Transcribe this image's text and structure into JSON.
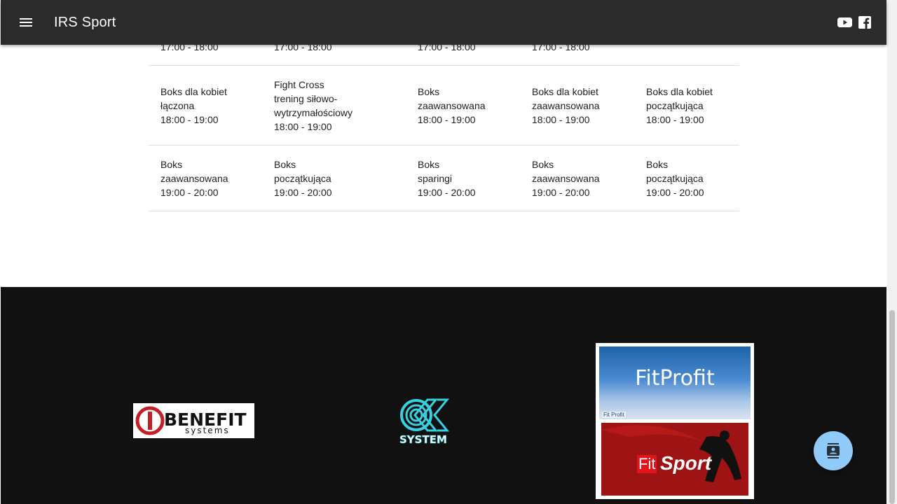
{
  "header": {
    "title": "IRS Sport",
    "menu_icon": "menu-icon",
    "social_icons": [
      "youtube-icon",
      "facebook-icon"
    ]
  },
  "schedule": {
    "rows": [
      {
        "cells": [
          [
            "17:00 - 18:00"
          ],
          [
            "17:00 - 18:00"
          ],
          [
            "17:00 - 18:00"
          ],
          [
            "17:00 - 18:00"
          ],
          []
        ]
      },
      {
        "cells": [
          [
            "Boks dla kobiet",
            "łączona",
            "18:00 - 19:00"
          ],
          [
            "Fight Cross",
            "trening siłowo-",
            "wytrzymałościowy",
            "18:00 - 19:00"
          ],
          [
            "Boks",
            "zaawansowana",
            "18:00 - 19:00"
          ],
          [
            "Boks dla kobiet",
            "zaawansowana",
            "18:00 - 19:00"
          ],
          [
            "Boks dla kobiet",
            "początkująca",
            "18:00 - 19:00"
          ]
        ]
      },
      {
        "cells": [
          [
            "Boks",
            "zaawansowana",
            "19:00 - 20:00"
          ],
          [
            "Boks",
            "początkująca",
            "19:00 - 20:00"
          ],
          [
            "Boks",
            "sparingi",
            "19:00 - 20:00"
          ],
          [
            "Boks",
            "zaawansowana",
            "19:00 - 20:00"
          ],
          [
            "Boks",
            "początkująca",
            "19:00 - 20:00"
          ]
        ]
      }
    ]
  },
  "footer": {
    "benefit_logo": {
      "main": "BENEFIT",
      "sub": "systems"
    },
    "ok_system_logo": {
      "text": "SYSTEM"
    },
    "fit_logo": {
      "fitprofit": "FitProfit",
      "fitprofit_small": "Fit Profit",
      "fit": "Fit",
      "sport": "Sport"
    }
  },
  "fab": {
    "icon": "contact-card-icon"
  },
  "colors": {
    "appbar": "#2b2b2b",
    "footer": "#111111",
    "fab": "#90caf9",
    "text": "#212121"
  }
}
